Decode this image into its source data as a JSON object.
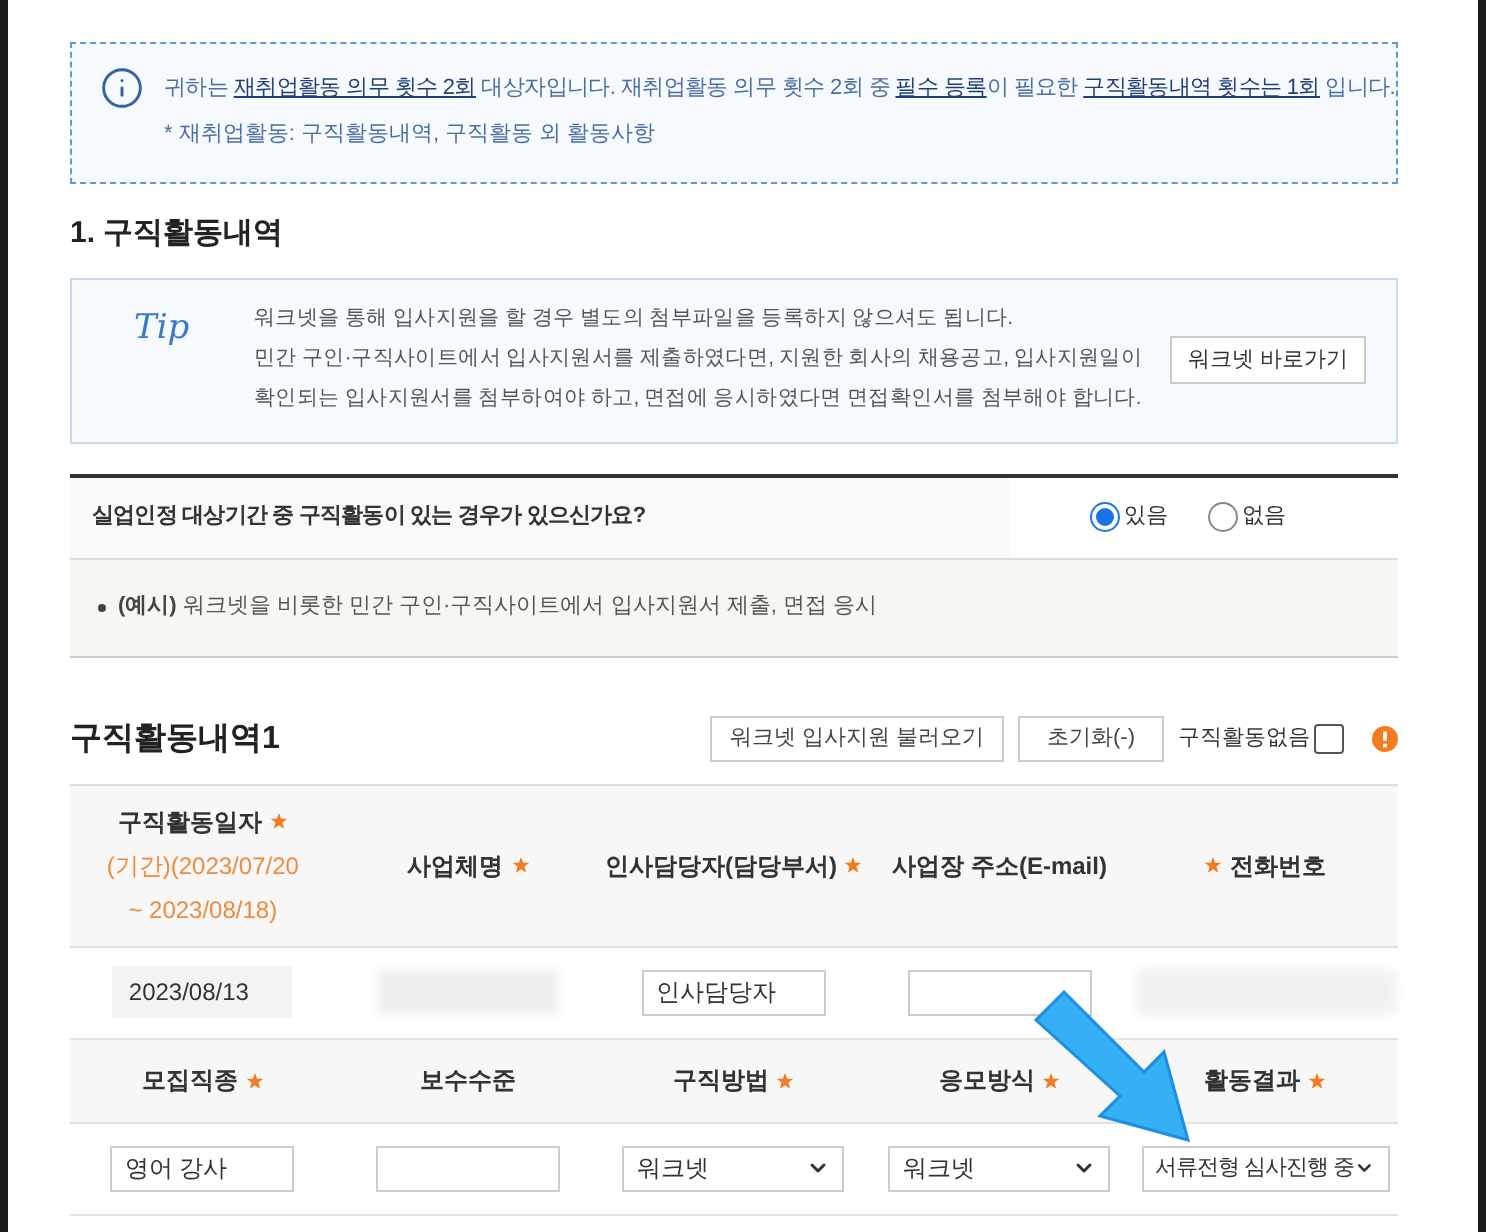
{
  "notice": {
    "segments": [
      {
        "kind": "plain",
        "text": "귀하는 "
      },
      {
        "kind": "link",
        "text": "재취업활동 의무 횟수 2회"
      },
      {
        "kind": "plain",
        "text": " 대상자입니다. 재취업활동 의무 횟수 2회 중 "
      },
      {
        "kind": "link",
        "text": "필수 등록"
      },
      {
        "kind": "plain",
        "text": "이 필요한 "
      },
      {
        "kind": "link",
        "text": "구직활동내역 횟수는 1회"
      },
      {
        "kind": "plain",
        "text": " 입니다."
      }
    ],
    "note": "* 재취업활동: 구직활동내역, 구직활동 외 활동사항"
  },
  "section_title": "1. 구직활동내역",
  "tip": {
    "label": "Tip",
    "lines": [
      "워크넷을 통해 입사지원을 할 경우 별도의 첨부파일을 등록하지 않으셔도 됩니다.",
      "민간 구인·구직사이트에서 입사지원서를 제출하였다면, 지원한 회사의 채용공고, 입사지원일이",
      "확인되는 입사지원서를 첨부하여야 하고, 면접에 응시하였다면 면접확인서를 첨부해야 합니다."
    ],
    "button": "워크넷 바로가기"
  },
  "question": {
    "text": "실업인정 대상기간 중 구직활동이 있는 경우가 있으신가요?",
    "options": [
      {
        "label": "있음",
        "selected": true
      },
      {
        "label": "없음",
        "selected": false
      }
    ]
  },
  "example": {
    "label": "(예시)",
    "text": "워크넷을 비롯한 민간 구인·구직사이트에서 입사지원서 제출, 면접 응시"
  },
  "history": {
    "title": "구직활동내역1",
    "buttons": [
      "워크넷 입사지원 불러오기",
      "초기화(-)"
    ],
    "no_activity": {
      "label": "구직활동없음",
      "checked": false
    }
  },
  "table": {
    "header_1": [
      {
        "kind": "trailing",
        "label": "구직활동일자",
        "required": true,
        "sub": [
          "(기간)(2023/07/20",
          "~ 2023/08/18)"
        ]
      },
      {
        "kind": "trailing",
        "label": "사업체명",
        "required": true
      },
      {
        "kind": "trailing",
        "label": "인사담당자(담당부서)",
        "required": true
      },
      {
        "kind": "trailing",
        "label": "사업장 주소(E-mail)",
        "required": false
      },
      {
        "kind": "leading",
        "label": "전화번호",
        "required": true
      }
    ],
    "row_1": [
      {
        "kind": "text",
        "value": "2023/08/13"
      },
      {
        "kind": "redacted"
      },
      {
        "kind": "input",
        "value": "인사담당자"
      },
      {
        "kind": "input"
      },
      {
        "kind": "redacted_phone"
      }
    ],
    "header_2": [
      {
        "kind": "trailing",
        "label": "모집직종",
        "required": true
      },
      {
        "kind": "trailing",
        "label": "보수수준",
        "required": false
      },
      {
        "kind": "trailing",
        "label": "구직방법",
        "required": true
      },
      {
        "kind": "trailing",
        "label": "응모방식",
        "required": true
      },
      {
        "kind": "trailing",
        "label": "활동결과",
        "required": true
      }
    ],
    "row_2": [
      {
        "kind": "input",
        "value": "영어 강사"
      },
      {
        "kind": "input"
      },
      {
        "kind": "select",
        "value": "워크넷"
      },
      {
        "kind": "select",
        "value": "워크넷"
      },
      {
        "kind": "select",
        "value": "서류전형 심사진행 중"
      }
    ]
  }
}
